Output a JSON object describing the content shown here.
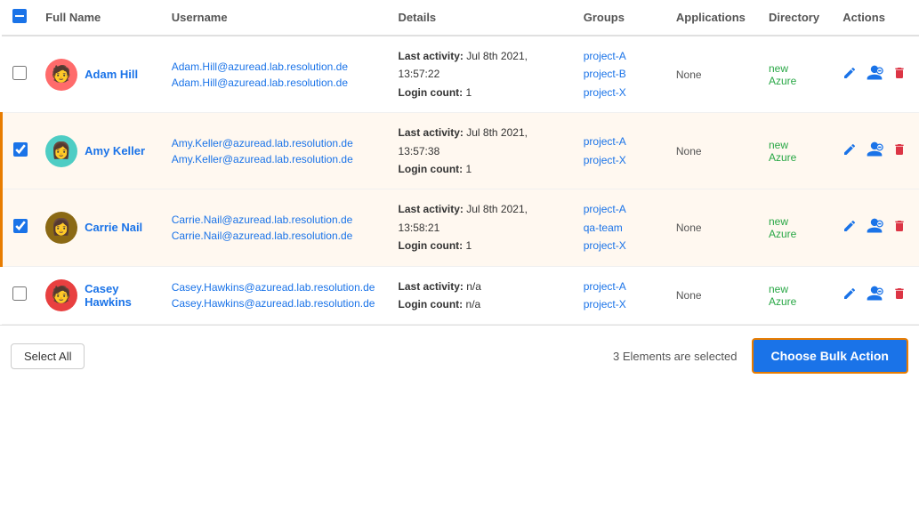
{
  "header": {
    "checkbox_deselect_label": "deselect-all",
    "columns": [
      "Full Name",
      "Username",
      "Details",
      "Groups",
      "Applications",
      "Directory",
      "Actions"
    ]
  },
  "users": [
    {
      "id": 1,
      "checked": false,
      "avatar_emoji": "🧑",
      "avatar_class": "avatar-adam",
      "full_name": "Adam Hill",
      "username1": "Adam.Hill@azuread.lab.resolution.de",
      "username2": "Adam.Hill@azuread.lab.resolution.de",
      "last_activity": "Jul 8th 2021, 13:57:22",
      "login_count": "1",
      "groups": [
        "project-A",
        "project-B",
        "project-X"
      ],
      "applications": "None",
      "directory": "new Azure",
      "selected": false
    },
    {
      "id": 2,
      "checked": true,
      "avatar_emoji": "👩",
      "avatar_class": "avatar-amy",
      "full_name": "Amy Keller",
      "username1": "Amy.Keller@azuread.lab.resolution.de",
      "username2": "Amy.Keller@azuread.lab.resolution.de",
      "last_activity": "Jul 8th 2021, 13:57:38",
      "login_count": "1",
      "groups": [
        "project-A",
        "project-X"
      ],
      "applications": "None",
      "directory": "new Azure",
      "selected": true
    },
    {
      "id": 3,
      "checked": true,
      "avatar_emoji": "👩",
      "avatar_class": "avatar-carrie",
      "full_name": "Carrie Nail",
      "username1": "Carrie.Nail@azuread.lab.resolution.de",
      "username2": "Carrie.Nail@azuread.lab.resolution.de",
      "last_activity": "Jul 8th 2021, 13:58:21",
      "login_count": "1",
      "groups": [
        "project-A",
        "qa-team",
        "project-X"
      ],
      "applications": "None",
      "directory": "new Azure",
      "selected": true
    },
    {
      "id": 4,
      "checked": false,
      "avatar_emoji": "🧑",
      "avatar_class": "avatar-casey",
      "full_name": "Casey Hawkins",
      "username1": "Casey.Hawkins@azuread.lab.resolution.de",
      "username2": "Casey.Hawkins@azuread.lab.resolution.de",
      "last_activity": "n/a",
      "login_count": "n/a",
      "groups": [
        "project-A",
        "project-X"
      ],
      "applications": "None",
      "directory": "new Azure",
      "selected": false
    }
  ],
  "footer": {
    "select_all_label": "Select All",
    "elements_selected_text": "3 Elements are selected",
    "bulk_action_label": "Choose Bulk Action"
  }
}
